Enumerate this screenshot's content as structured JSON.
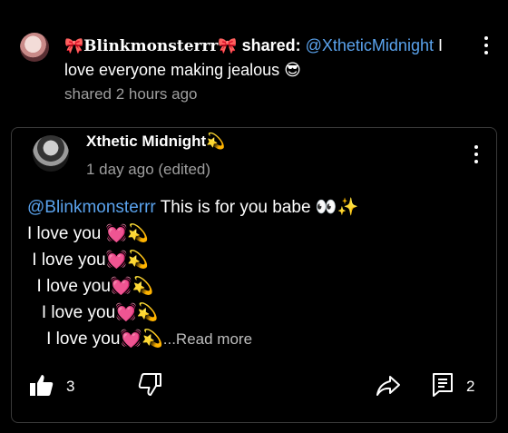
{
  "share": {
    "sharer": "🎀Blinkmonsterrr🎀",
    "shared_word": "shared:",
    "mention": "@XtheticMidnight",
    "message_line1_rest": " I",
    "message_line2": "love everyone making jealous 😎",
    "time": "shared 2 hours ago"
  },
  "post": {
    "author": "Xthetic Midnight💫",
    "time": "1 day ago (edited)",
    "mention": "@Blinkmonsterrr",
    "first_line_rest": " This is for you babe 👀✨",
    "lines": [
      "I love you 💓💫",
      " I love you💓💫",
      "  I love you💓💫",
      "   I love you💓💫",
      "    I love you💓💫"
    ],
    "read_more": "...Read more"
  },
  "actions": {
    "like_count": "3",
    "reply_count": "2",
    "like_icon": "thumbs-up-icon",
    "dislike_icon": "thumbs-down-icon",
    "share_icon": "share-arrow-icon",
    "reply_icon": "comment-icon"
  },
  "colors": {
    "background": "#000000",
    "mention": "#5aa2ec",
    "muted": "#9e9e9e",
    "card_border": "#3a3a3a"
  }
}
